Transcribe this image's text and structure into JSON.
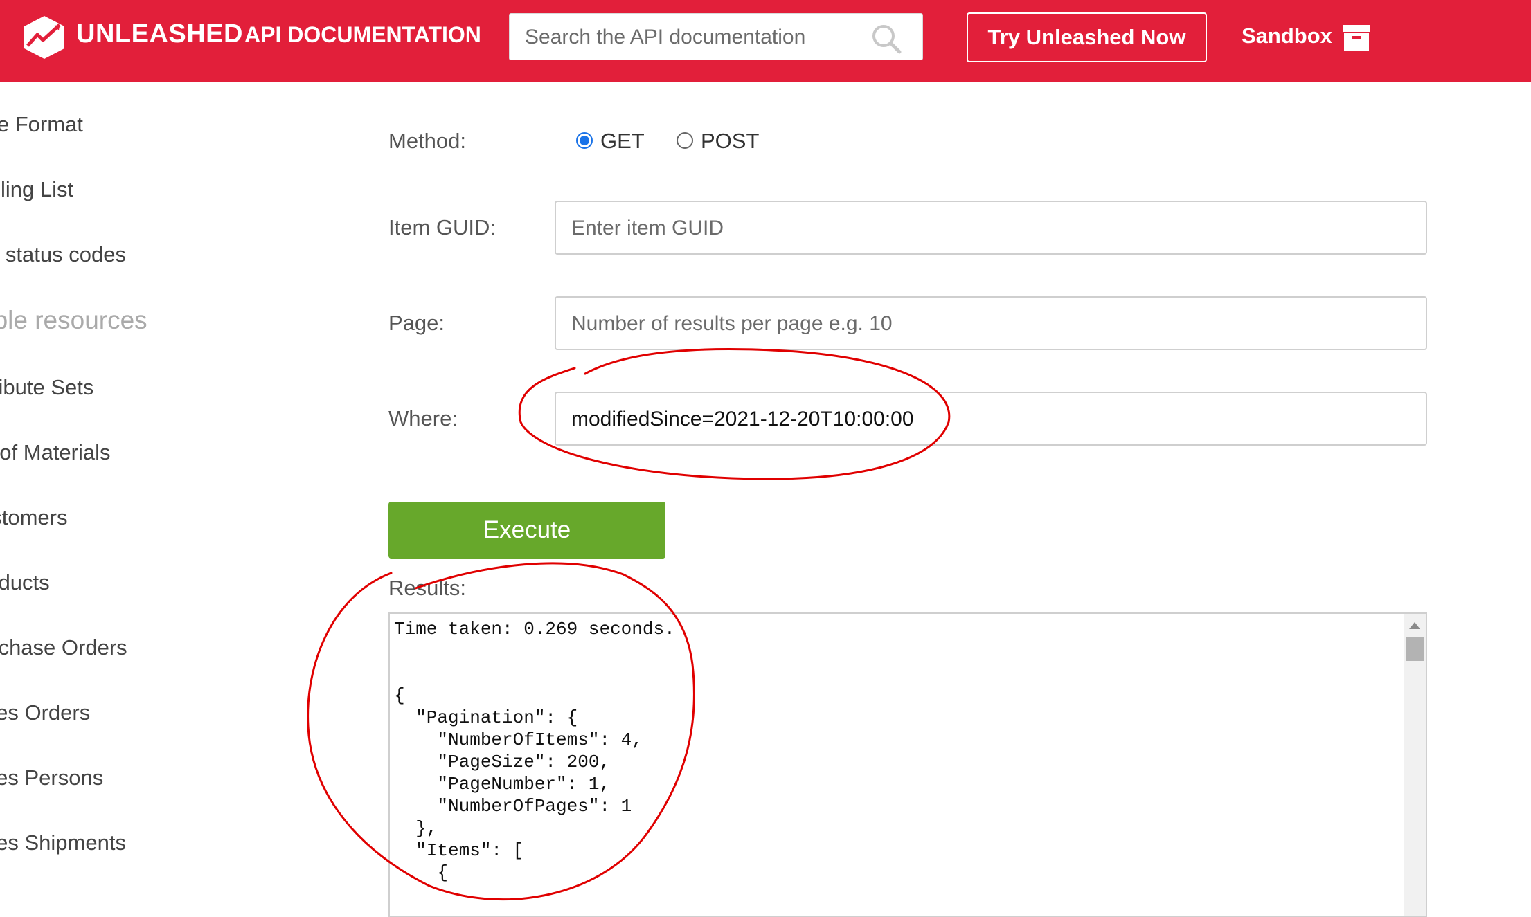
{
  "header": {
    "brand": "UNLEASHED",
    "doc_title": "API DOCUMENTATION",
    "search_placeholder": "Search the API documentation",
    "try_button": "Try Unleashed Now",
    "sandbox": "Sandbox",
    "background_color": "#e21f3a"
  },
  "sidebar": {
    "items_top": [
      "ate Format",
      "lailing List",
      "PI status codes"
    ],
    "section_heading": "able resources",
    "items": [
      "ttribute Sets",
      "ill of Materials",
      "ustomers",
      "roducts",
      "urchase Orders",
      "ales Orders",
      "ales Persons",
      "ales Shipments"
    ]
  },
  "form": {
    "method_label": "Method:",
    "method_options": [
      "GET",
      "POST"
    ],
    "method_selected": "GET",
    "guid_label": "Item GUID:",
    "guid_placeholder": "Enter item GUID",
    "page_label": "Page:",
    "page_placeholder": "Number of results per page e.g. 10",
    "where_label": "Where:",
    "where_value": "modifiedSince=2021-12-20T10:00:00",
    "execute_button": "Execute",
    "execute_color": "#67a82b",
    "results_label": "Results:"
  },
  "results": {
    "text": "Time taken: 0.269 seconds.\n\n\n{\n  \"Pagination\": {\n    \"NumberOfItems\": 4,\n    \"PageSize\": 200,\n    \"PageNumber\": 1,\n    \"NumberOfPages\": 1\n  },\n  \"Items\": [\n    {"
  },
  "annotation_color": "#e00000"
}
